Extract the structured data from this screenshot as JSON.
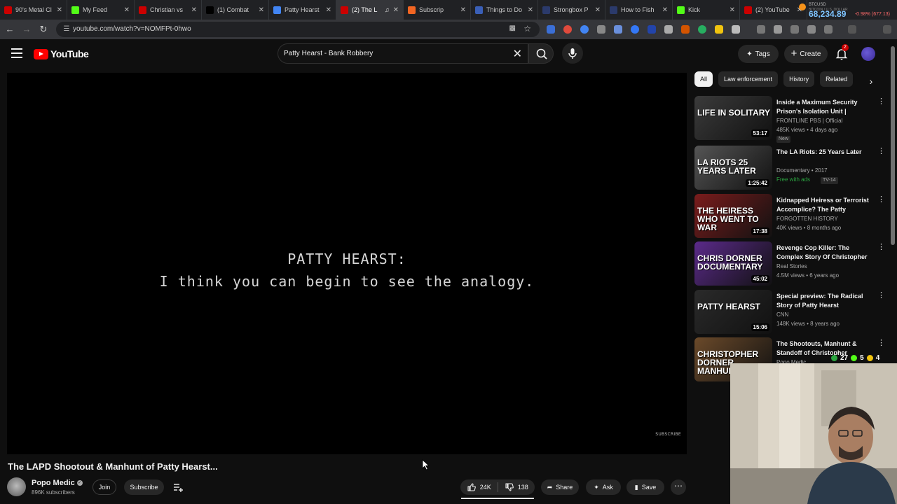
{
  "browser": {
    "tabs": [
      {
        "label": "90's Metal Cl",
        "fav": "#cc0000",
        "active": false
      },
      {
        "label": "My Feed",
        "fav": "#53fc18",
        "active": false
      },
      {
        "label": "Christian vs",
        "fav": "#cc0000",
        "active": false
      },
      {
        "label": "(1) Combat",
        "fav": "#000000",
        "active": false
      },
      {
        "label": "Patty Hearst",
        "fav": "#4285f4",
        "active": false
      },
      {
        "label": "(2) The L",
        "fav": "#cc0000",
        "active": true
      },
      {
        "label": "Subscrip",
        "fav": "#f26522",
        "active": false
      },
      {
        "label": "Things to Do",
        "fav": "#3a5fb7",
        "active": false
      },
      {
        "label": "Strongbox P",
        "fav": "#2b3a6b",
        "active": false
      },
      {
        "label": "How to Fish",
        "fav": "#2b3a6b",
        "active": false
      },
      {
        "label": "Kick",
        "fav": "#53fc18",
        "active": false
      },
      {
        "label": "(2) YouTube",
        "fav": "#cc0000",
        "active": false
      }
    ],
    "url": "youtube.com/watch?v=NOMFPt-0hwo",
    "btc": {
      "symbol": "BTCUSD",
      "name": "BITCOIN / U.S. DOLLAR",
      "price": "68,234.89",
      "change": "-0.98% (677.13)"
    }
  },
  "header": {
    "logo": "YouTube",
    "search_query": "Patty Hearst - Bank Robbery",
    "tags_label": "Tags",
    "create_label": "Create",
    "notif_count": "2"
  },
  "player": {
    "caption_line1": "PATTY HEARST:",
    "caption_line2": "I think you can begin to see the analogy.",
    "watermark": "SUBSCRIBE"
  },
  "video": {
    "title": "The LAPD Shootout & Manhunt of Patty Hearst...",
    "channel": "Popo Medic",
    "subscribers": "896K subscribers",
    "join_label": "Join",
    "subscribe_label": "Subscribe",
    "likes": "24K",
    "dislikes": "138",
    "share_label": "Share",
    "ask_label": "Ask",
    "save_label": "Save"
  },
  "sidebar": {
    "chips": [
      "All",
      "Law enforcement",
      "History",
      "Related"
    ],
    "recommendations": [
      {
        "title": "Inside a Maximum Security Prison's Isolation Unit | Solitar...",
        "meta1": "FRONTLINE PBS | Official",
        "meta2": "485K views • 4 days ago",
        "badge": "New",
        "duration": "53:17",
        "thumb_text": "LIFE IN SOLITARY",
        "thumb_color": "#3b3b3b"
      },
      {
        "title": "The LA Riots: 25 Years Later",
        "meta1": "Documentary • 2017",
        "meta2": "Free with ads",
        "badge": "TV-14",
        "duration": "1:25:42",
        "thumb_text": "LA RIOTS 25 YEARS LATER",
        "thumb_color": "#555"
      },
      {
        "title": "Kidnapped Heiress or Terrorist Accomplice? The Patty Hearst...",
        "meta1": "FORGOTTEN HISTORY",
        "meta2": "40K views • 8 months ago",
        "badge": "",
        "duration": "17:38",
        "thumb_text": "THE HEIRESS WHO WENT TO WAR",
        "thumb_color": "#7a1c1c"
      },
      {
        "title": "Revenge Cop Killer: The Complex Story Of Christopher ...",
        "meta1": "Real Stories",
        "meta2": "4.5M views • 6 years ago",
        "badge": "",
        "duration": "45:02",
        "thumb_text": "CHRIS DORNER DOCUMENTARY",
        "thumb_color": "#5b2a8a"
      },
      {
        "title": "Special preview: The Radical Story of Patty Hearst",
        "meta1": "CNN",
        "meta2": "148K views • 8 years ago",
        "badge": "",
        "duration": "15:06",
        "thumb_text": "PATTY HEARST",
        "thumb_color": "#2a2a2a"
      },
      {
        "title": "The Shootouts, Manhunt & Standoff of Christopher Dorner...",
        "meta1": "Popo Medic",
        "meta2": "",
        "badge": "",
        "duration": "",
        "thumb_text": "CHRISTOPHER DORNER MANHUNT",
        "thumb_color": "#6b4a2a"
      }
    ]
  },
  "overlay": {
    "stream_stats": [
      "27",
      "5",
      "4"
    ]
  }
}
